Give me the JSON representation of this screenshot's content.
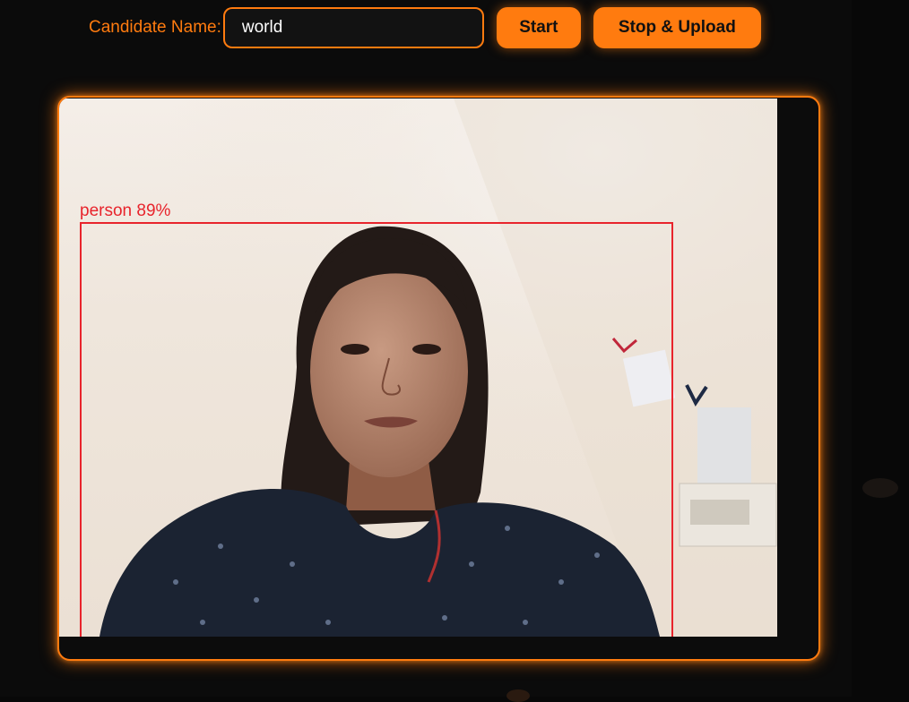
{
  "controls": {
    "candidate_label": "Candidate Name:",
    "candidate_value": "world",
    "start_label": "Start",
    "stop_label": "Stop & Upload"
  },
  "video": {
    "detection": {
      "label": "person 89%"
    }
  },
  "colors": {
    "accent": "#ff7b0f",
    "background": "#0b0b0b",
    "detection": "#e8242c"
  }
}
